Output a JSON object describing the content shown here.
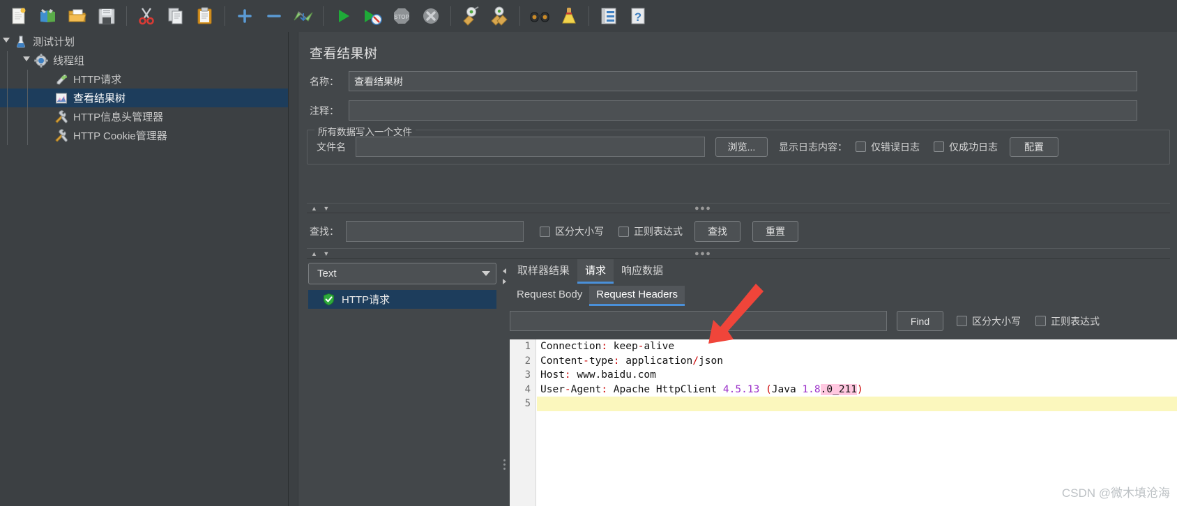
{
  "toolbar": {
    "items": [
      {
        "name": "new-file-icon",
        "label": "新建"
      },
      {
        "name": "new-from-template-icon",
        "label": "模板"
      },
      {
        "name": "open-folder-icon",
        "label": "打开"
      },
      {
        "name": "save-icon",
        "label": "保存"
      },
      {
        "name": "cut-icon",
        "label": "剪切"
      },
      {
        "name": "copy-icon",
        "label": "复制"
      },
      {
        "name": "paste-icon",
        "label": "粘贴"
      },
      {
        "name": "expand-all-icon",
        "label": "展开"
      },
      {
        "name": "collapse-all-icon",
        "label": "折叠"
      },
      {
        "name": "toggle-icon",
        "label": "启用/禁用"
      },
      {
        "name": "start-icon",
        "label": "启动"
      },
      {
        "name": "start-no-timers-icon",
        "label": "无间隔启动"
      },
      {
        "name": "stop-icon",
        "label": "停止"
      },
      {
        "name": "shutdown-icon",
        "label": "关闭"
      },
      {
        "name": "clear-icon",
        "label": "清除"
      },
      {
        "name": "clear-all-icon",
        "label": "清除全部"
      },
      {
        "name": "search-icon",
        "label": "搜索"
      },
      {
        "name": "reset-search-icon",
        "label": "重置搜索"
      },
      {
        "name": "function-helper-icon",
        "label": "函数助手"
      },
      {
        "name": "help-icon",
        "label": "帮助"
      }
    ]
  },
  "tree": {
    "nodes": [
      {
        "label": "测试计划",
        "icon": "test-plan-icon",
        "depth": 0,
        "selected": false,
        "expander": "open"
      },
      {
        "label": "线程组",
        "icon": "thread-group-icon",
        "depth": 1,
        "selected": false,
        "expander": "open"
      },
      {
        "label": "HTTP请求",
        "icon": "http-request-icon",
        "depth": 2,
        "selected": false,
        "expander": "none"
      },
      {
        "label": "查看结果树",
        "icon": "view-results-tree-icon",
        "depth": 2,
        "selected": true,
        "expander": "none"
      },
      {
        "label": "HTTP信息头管理器",
        "icon": "header-manager-icon",
        "depth": 2,
        "selected": false,
        "expander": "none"
      },
      {
        "label": "HTTP Cookie管理器",
        "icon": "cookie-manager-icon",
        "depth": 2,
        "selected": false,
        "expander": "none"
      }
    ]
  },
  "panel": {
    "title": "查看结果树",
    "name_label": "名称：",
    "name_value": "查看结果树",
    "comment_label": "注释：",
    "comment_value": "",
    "file_group_label": "所有数据写入一个文件",
    "filename_label": "文件名",
    "filename_value": "",
    "browse_button": "浏览...",
    "log_display_label": "显示日志内容：",
    "errors_only_label": "仅错误日志",
    "success_only_label": "仅成功日志",
    "configure_button": "配置",
    "search_label": "查找：",
    "search_value": "",
    "case_sensitive_label": "区分大小写",
    "regex_label": "正则表达式",
    "find_button": "查找",
    "reset_button": "重置"
  },
  "results": {
    "render_selected": "Text",
    "render_options": [
      "Text"
    ],
    "items": [
      {
        "label": "HTTP请求",
        "icon": "success-shield-icon",
        "selected": true
      }
    ]
  },
  "detail": {
    "tabs": [
      {
        "label": "取样器结果",
        "active": false
      },
      {
        "label": "请求",
        "active": true
      },
      {
        "label": "响应数据",
        "active": false
      }
    ],
    "subtabs": [
      {
        "label": "Request Body",
        "active": false
      },
      {
        "label": "Request Headers",
        "active": true
      }
    ],
    "find_value": "",
    "find_button": "Find",
    "case_sensitive_label": "区分大小写",
    "regex_label": "正则表达式"
  },
  "code": {
    "lines": [
      {
        "num": "1",
        "highlight": false,
        "tokens": [
          {
            "t": "Connection",
            "c": "plain"
          },
          {
            "t": ":",
            "c": "punc"
          },
          {
            "t": " keep",
            "c": "plain"
          },
          {
            "t": "-",
            "c": "punc"
          },
          {
            "t": "alive",
            "c": "plain"
          }
        ]
      },
      {
        "num": "2",
        "highlight": false,
        "tokens": [
          {
            "t": "Content",
            "c": "plain"
          },
          {
            "t": "-",
            "c": "punc"
          },
          {
            "t": "type",
            "c": "plain"
          },
          {
            "t": ":",
            "c": "punc"
          },
          {
            "t": " application",
            "c": "plain"
          },
          {
            "t": "/",
            "c": "punc"
          },
          {
            "t": "json",
            "c": "plain"
          }
        ]
      },
      {
        "num": "3",
        "highlight": false,
        "tokens": [
          {
            "t": "Host",
            "c": "plain"
          },
          {
            "t": ":",
            "c": "punc"
          },
          {
            "t": " www.baidu.com",
            "c": "plain"
          }
        ]
      },
      {
        "num": "4",
        "highlight": false,
        "tokens": [
          {
            "t": "User",
            "c": "plain"
          },
          {
            "t": "-",
            "c": "punc"
          },
          {
            "t": "Agent",
            "c": "plain"
          },
          {
            "t": ":",
            "c": "punc"
          },
          {
            "t": " Apache HttpClient ",
            "c": "plain"
          },
          {
            "t": "4.5.13",
            "c": "num"
          },
          {
            "t": " (",
            "c": "punc"
          },
          {
            "t": "Java ",
            "c": "plain"
          },
          {
            "t": "1.8",
            "c": "num"
          },
          {
            "t": ".0_211",
            "c": "sel"
          },
          {
            "t": ")",
            "c": "punc"
          }
        ]
      },
      {
        "num": "5",
        "highlight": true,
        "tokens": []
      }
    ]
  },
  "watermark": "CSDN @微木填沧海",
  "colors": {
    "accent": "#4a90d9",
    "selection": "#1d3d5c",
    "panel": "#43474a",
    "background": "#3c4043",
    "code_bg": "#ffffff",
    "highlight_row": "#fbf7bd",
    "arrow": "#f0453a",
    "punctuation": "#cc0000",
    "number": "#9b30c9",
    "selected_text_bg": "#ffc8e0"
  }
}
